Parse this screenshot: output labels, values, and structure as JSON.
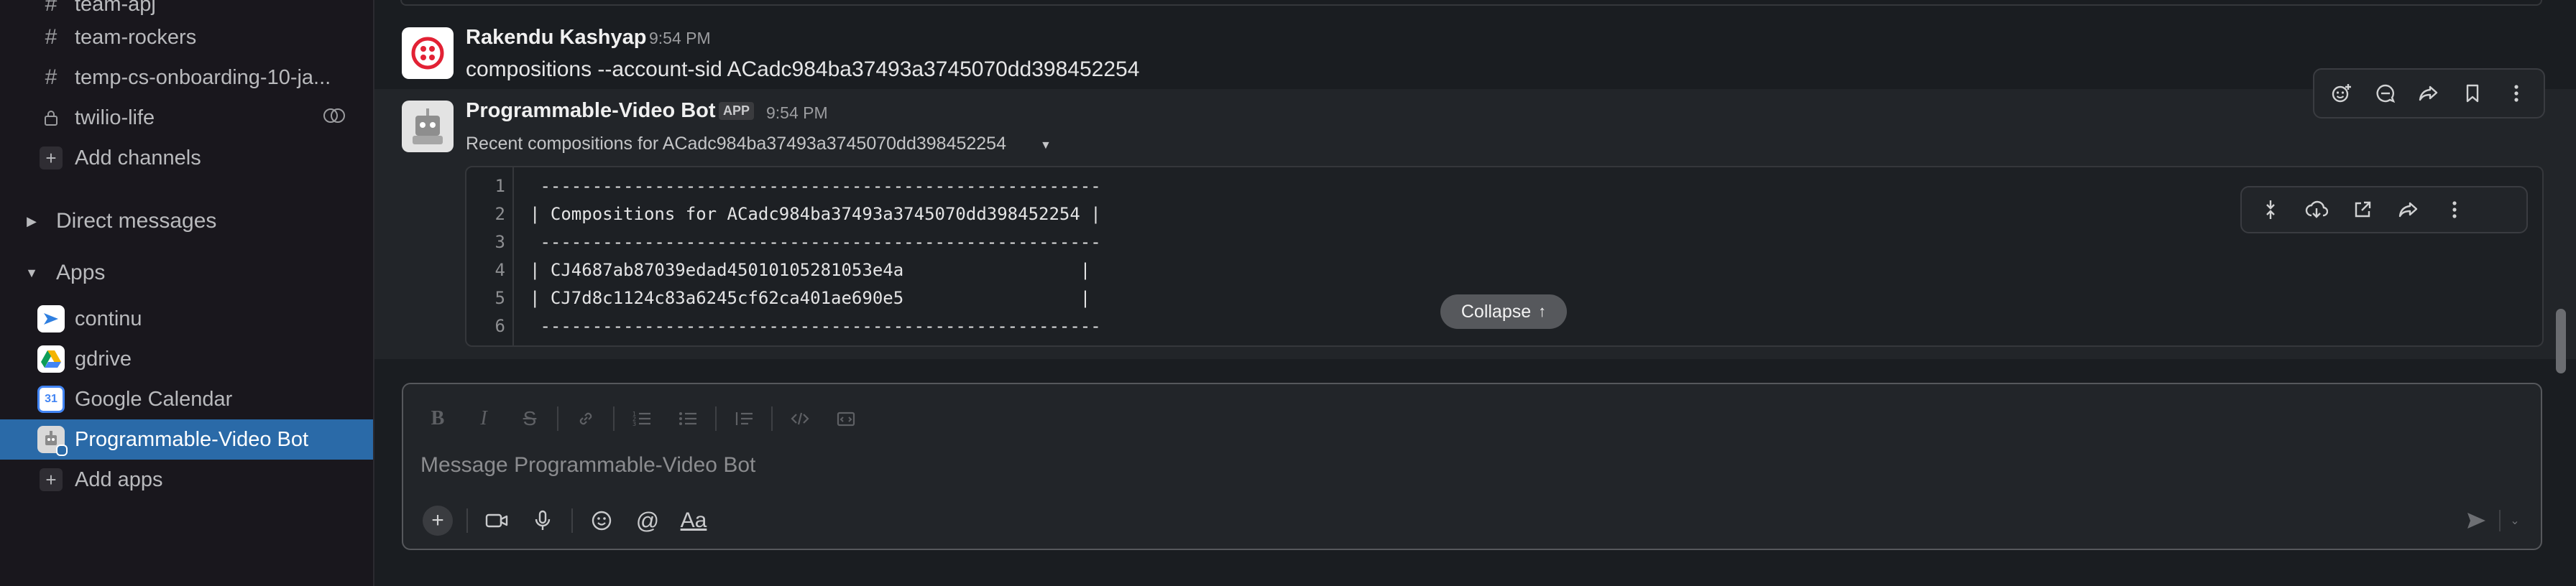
{
  "sidebar": {
    "channels": [
      {
        "label": "team-apj",
        "icon": "hash-icon"
      },
      {
        "label": "team-rockers",
        "icon": "hash-icon"
      },
      {
        "label": "temp-cs-onboarding-10-ja...",
        "icon": "hash-icon"
      },
      {
        "label": "twilio-life",
        "icon": "lock-icon"
      }
    ],
    "add_channels": "Add channels",
    "direct_messages": "Direct messages",
    "apps_header": "Apps",
    "apps": [
      {
        "label": "continu",
        "icon": "continu-app-icon"
      },
      {
        "label": "gdrive",
        "icon": "gdrive-app-icon"
      },
      {
        "label": "Google Calendar",
        "icon": "google-calendar-app-icon"
      },
      {
        "label": "Programmable-Video Bot",
        "icon": "video-bot-app-icon",
        "active": true
      }
    ],
    "add_apps": "Add apps",
    "active_color": "#2a6aa8"
  },
  "messages": [
    {
      "author": "Rakendu Kashyap",
      "time": "9:54 PM",
      "text": "compositions --account-sid ACadc984ba37493a3745070dd398452254"
    },
    {
      "author": "Programmable-Video Bot",
      "app_tag": "APP",
      "time": "9:54 PM",
      "subtitle": "Recent compositions for ACadc984ba37493a3745070dd398452254",
      "code_lines": [
        {
          "n": "1",
          "text": " ------------------------------------------------------"
        },
        {
          "n": "2",
          "text": "| Compositions for ACadc984ba37493a3745070dd398452254 |"
        },
        {
          "n": "3",
          "text": " ------------------------------------------------------"
        },
        {
          "n": "4",
          "text": "| CJ4687ab87039edad45010105281053e4a                 |"
        },
        {
          "n": "5",
          "text": "| CJ7d8c1124c83a6245cf62ca401ae690e5                 |"
        },
        {
          "n": "6",
          "text": " ------------------------------------------------------"
        }
      ],
      "collapse_label": "Collapse"
    }
  ],
  "composer": {
    "placeholder": "Message Programmable-Video Bot"
  }
}
